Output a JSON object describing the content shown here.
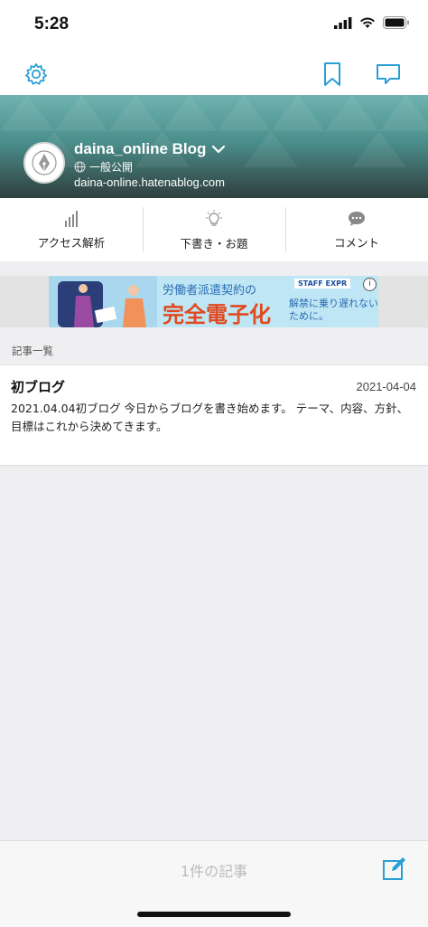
{
  "status_bar": {
    "time": "5:28"
  },
  "blog": {
    "title": "daina_online Blog",
    "visibility": "一般公開",
    "url": "daina-online.hatenablog.com"
  },
  "actions": [
    {
      "label": "アクセス解析",
      "icon": "bar-chart-icon"
    },
    {
      "label": "下書き・お題",
      "icon": "lightbulb-icon"
    },
    {
      "label": "コメント",
      "icon": "comment-bubble-icon"
    }
  ],
  "ad": {
    "line1": "労働者派遣契約の",
    "line2": "完全電子化",
    "line3": "解禁に乗り遅れないために。",
    "brand": "STAFF EXPR"
  },
  "section_header": "記事一覧",
  "articles": [
    {
      "title": "初ブログ",
      "date": "2021-04-04",
      "excerpt": "2021.04.04初ブログ 今日からブログを書き始めます。 テーマ、内容、方針、目標はこれから決めてきます。"
    }
  ],
  "footer": {
    "post_count": "1件の記事"
  },
  "colors": {
    "accent": "#2a9fd6",
    "hero": "#4b8f8c"
  }
}
